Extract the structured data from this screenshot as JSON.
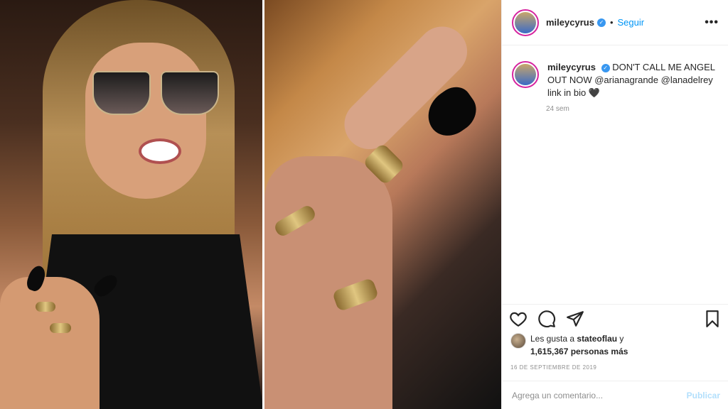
{
  "post": {
    "username": "mileycyrus",
    "follow_label": "Seguir",
    "separator": "•",
    "more_icon": "more-horizontal-icon",
    "caption_username": "mileycyrus",
    "caption_text": "DON'T CALL ME ANGEL OUT NOW @arianagrande @lanadelrey link in bio 🖤",
    "time_ago": "24 sem",
    "likes_prefix": "Les gusta a",
    "likes_user": "stateoflau",
    "likes_joiner": "y",
    "likes_count": "1,615,367 personas más",
    "date": "16 DE SEPTIEMBRE DE 2019",
    "comment_placeholder": "Agrega un comentario...",
    "publish_label": "Publicar"
  },
  "colors": {
    "accent": "#0095f6",
    "verified": "#3897f0",
    "text": "#262626",
    "muted": "#8e8e8e",
    "publish_disabled": "#b2dffc"
  },
  "icons": {
    "like": "heart-icon",
    "comment": "comment-icon",
    "share": "paper-plane-icon",
    "save": "bookmark-icon",
    "verified": "verified-badge-icon"
  }
}
